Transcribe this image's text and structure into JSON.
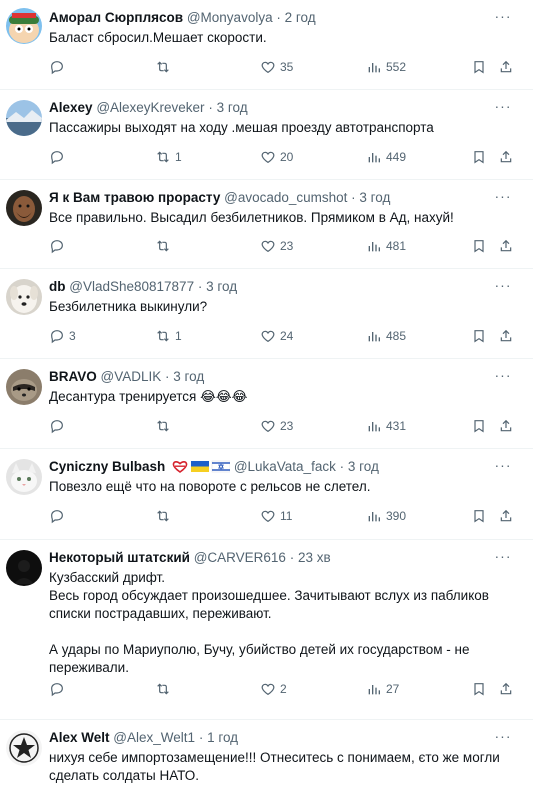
{
  "tweets": [
    {
      "name": "Аморал Сюрплясов",
      "handle": "@Monyavolya",
      "dot": "·",
      "time": "2 год",
      "text": "Баласт сбросил.Мешает скорости.",
      "reply": "",
      "retweet": "",
      "like": "35",
      "views": "552",
      "avatar": "cartoon-avatar"
    },
    {
      "name": "Alexey",
      "handle": "@AlexeyKreveker",
      "dot": "·",
      "time": "3 год",
      "text": "Пассажиры выходят на ходу .мешая проезду автотранспорта",
      "reply": "",
      "retweet": "1",
      "like": "20",
      "views": "449",
      "avatar": "landscape-avatar"
    },
    {
      "name": "Я к Вам травою прорасту",
      "handle": "@avocado_cumshot",
      "dot": "·",
      "time": "3 год",
      "text": "Все правильно. Высадил безбилетников. Прямиком в Ад, нахуй!",
      "reply": "",
      "retweet": "",
      "like": "23",
      "views": "481",
      "avatar": "man-avatar"
    },
    {
      "name": "db",
      "handle": "@VladShe80817877",
      "dot": "·",
      "time": "3 год",
      "text": "Безбилетника выкинули?",
      "reply": "3",
      "retweet": "1",
      "like": "24",
      "views": "485",
      "avatar": "dog-avatar"
    },
    {
      "name": "BRAVO",
      "handle": "@VADLIK",
      "dot": "·",
      "time": "3 год",
      "text": "Десантура тренируется 😂😂😂",
      "reply": "",
      "retweet": "",
      "like": "23",
      "views": "431",
      "avatar": "raccoon-avatar"
    },
    {
      "name": "Cyniczny Bulbash",
      "handle": "@LukaVata_fack",
      "dot": "·",
      "time": "3 год",
      "text": "Повезло ещё что на повороте с рельсов не слетел.",
      "reply": "",
      "retweet": "",
      "like": "11",
      "views": "390",
      "avatar": "cat-avatar"
    },
    {
      "name": "Некоторый штатский",
      "handle": "@CARVER616",
      "dot": "·",
      "time": "23 хв",
      "text": "Кузбасский дрифт.\nВесь город обсуждает произошедшее. Зачитывают вслух из пабликов списки пострадавших, переживают.\n\nА удары по Мариуполю, Бучу, убийство детей их государством - не переживали.",
      "reply": "",
      "retweet": "",
      "like": "2",
      "views": "27",
      "avatar": "dark-avatar"
    },
    {
      "name": "Alex Welt",
      "handle": "@Alex_Welt1",
      "dot": "·",
      "time": "1 год",
      "text": "нихуя себе импортозамещение!!! Отнеситесь с понимаем, єто же могли сделать солдаты НАТО.",
      "avatar": "emblem-avatar"
    }
  ],
  "colors": {
    "muted": "#536471",
    "text": "#0f1419",
    "divider": "#eff3f4"
  },
  "icons": [
    "reply-icon",
    "retweet-icon",
    "like-icon",
    "views-icon",
    "bookmark-icon",
    "share-icon",
    "more-icon"
  ]
}
